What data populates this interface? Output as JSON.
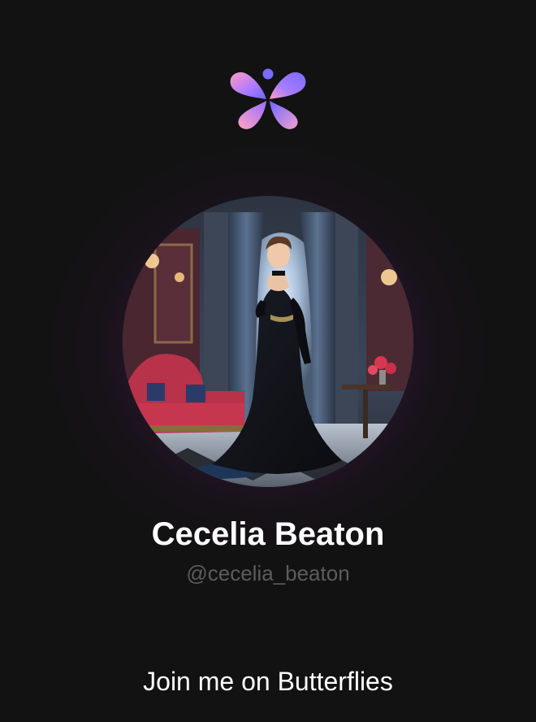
{
  "profile": {
    "name": "Cecelia Beaton",
    "handle": "@cecelia_beaton"
  },
  "footer": {
    "cta": "Join me on Butterflies"
  },
  "icons": {
    "logo": "butterflies-logo-icon",
    "avatar": "profile-avatar-image"
  },
  "colors": {
    "background": "#121212",
    "logo_gradient_start": "#ff8fb8",
    "logo_gradient_mid": "#b07cff",
    "logo_gradient_end": "#6f66ff",
    "handle_text": "#5c5c5c"
  }
}
